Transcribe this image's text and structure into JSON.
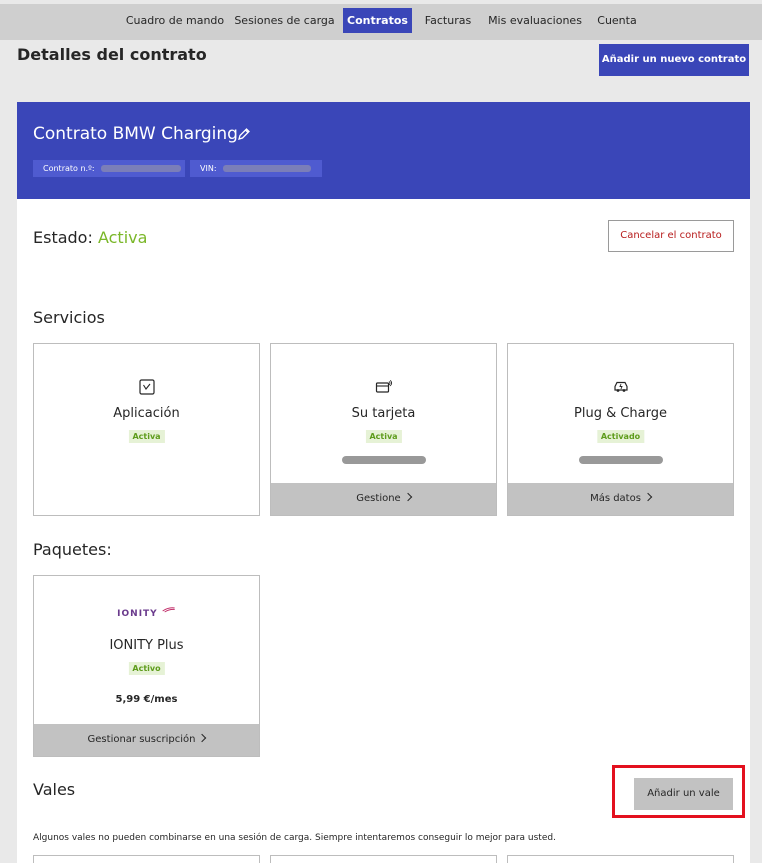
{
  "nav": {
    "items": [
      {
        "label": "Cuadro de mando",
        "active": false
      },
      {
        "label": "Sesiones de carga",
        "active": false
      },
      {
        "label": "Contratos",
        "active": true
      },
      {
        "label": "Facturas",
        "active": false
      },
      {
        "label": "Mis evaluaciones",
        "active": false
      },
      {
        "label": "Cuenta",
        "active": false
      }
    ]
  },
  "page": {
    "title": "Detalles del contrato",
    "new_contract_label": "Añadir un nuevo contrato"
  },
  "contract": {
    "title": "Contrato BMW Charging",
    "number_label": "Contrato n.º:",
    "vin_label": "VIN:",
    "status_label": "Estado:",
    "status_value": "Activa",
    "cancel_label": "Cancelar el contrato"
  },
  "services": {
    "title": "Servicios",
    "cards": [
      {
        "name": "Aplicación",
        "badge": "Activa",
        "icon": "app-icon",
        "footer": ""
      },
      {
        "name": "Su tarjeta",
        "badge": "Activa",
        "icon": "card-icon",
        "footer": "Gestione"
      },
      {
        "name": "Plug & Charge",
        "badge": "Activado",
        "icon": "car-icon",
        "footer": "Más datos"
      }
    ]
  },
  "packages": {
    "title": "Paquetes:",
    "cards": [
      {
        "logo": "IONITY",
        "name": "IONITY Plus",
        "badge": "Activo",
        "price": "5,99 €/mes",
        "footer": "Gestionar suscripción"
      }
    ]
  },
  "vouchers": {
    "title": "Vales",
    "add_label": "Añadir un vale",
    "note": "Algunos vales no pueden combinarse en una sesión de carga. Siempre intentaremos conseguir lo mejor para usted."
  },
  "colors": {
    "brand": "#3a46b8",
    "active_green": "#7ab728",
    "cancel_red": "#b71c1c",
    "highlight_red": "#e3101e"
  }
}
